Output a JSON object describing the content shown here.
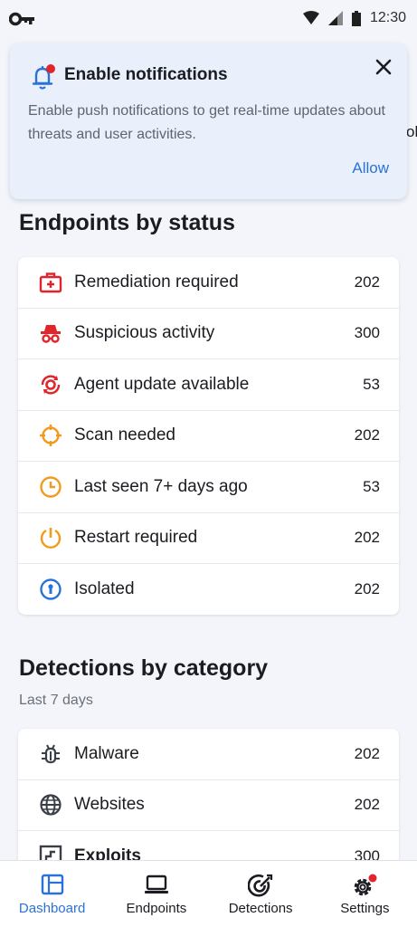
{
  "status_bar": {
    "time": "12:30"
  },
  "peek_text": "ol",
  "banner": {
    "title": "Enable notifications",
    "body": "Enable push notifications to get real-time updates about threats and user activities.",
    "allow_label": "Allow"
  },
  "endpoints": {
    "title": "Endpoints by status",
    "items": [
      {
        "label": "Remediation required",
        "count": "202",
        "icon": "medkit-icon",
        "color": "#e0262c"
      },
      {
        "label": "Suspicious activity",
        "count": "300",
        "icon": "spy-icon",
        "color": "#e0262c"
      },
      {
        "label": "Agent update available",
        "count": "53",
        "icon": "update-gear-icon",
        "color": "#e0262c"
      },
      {
        "label": "Scan needed",
        "count": "202",
        "icon": "crosshair-icon",
        "color": "#f29a1c"
      },
      {
        "label": "Last seen 7+ days ago",
        "count": "53",
        "icon": "clock-icon",
        "color": "#f29a1c"
      },
      {
        "label": "Restart required",
        "count": "202",
        "icon": "restart-icon",
        "color": "#f29a1c"
      },
      {
        "label": "Isolated",
        "count": "202",
        "icon": "lock-circle-icon",
        "color": "#2a72d8"
      }
    ]
  },
  "detections": {
    "title": "Detections by category",
    "subtitle": "Last 7 days",
    "items": [
      {
        "label": "Malware",
        "count": "202",
        "icon": "bug-icon"
      },
      {
        "label": "Websites",
        "count": "202",
        "icon": "globe-icon"
      },
      {
        "label": "Exploits",
        "count": "300",
        "icon": "exploit-icon"
      }
    ]
  },
  "nav": {
    "items": [
      {
        "label": "Dashboard",
        "icon": "dashboard-icon"
      },
      {
        "label": "Endpoints",
        "icon": "laptop-icon"
      },
      {
        "label": "Detections",
        "icon": "target-icon"
      },
      {
        "label": "Settings",
        "icon": "gear-icon"
      }
    ]
  },
  "colors": {
    "accent": "#2a72d8",
    "danger": "#e0262c",
    "warning": "#f29a1c"
  }
}
